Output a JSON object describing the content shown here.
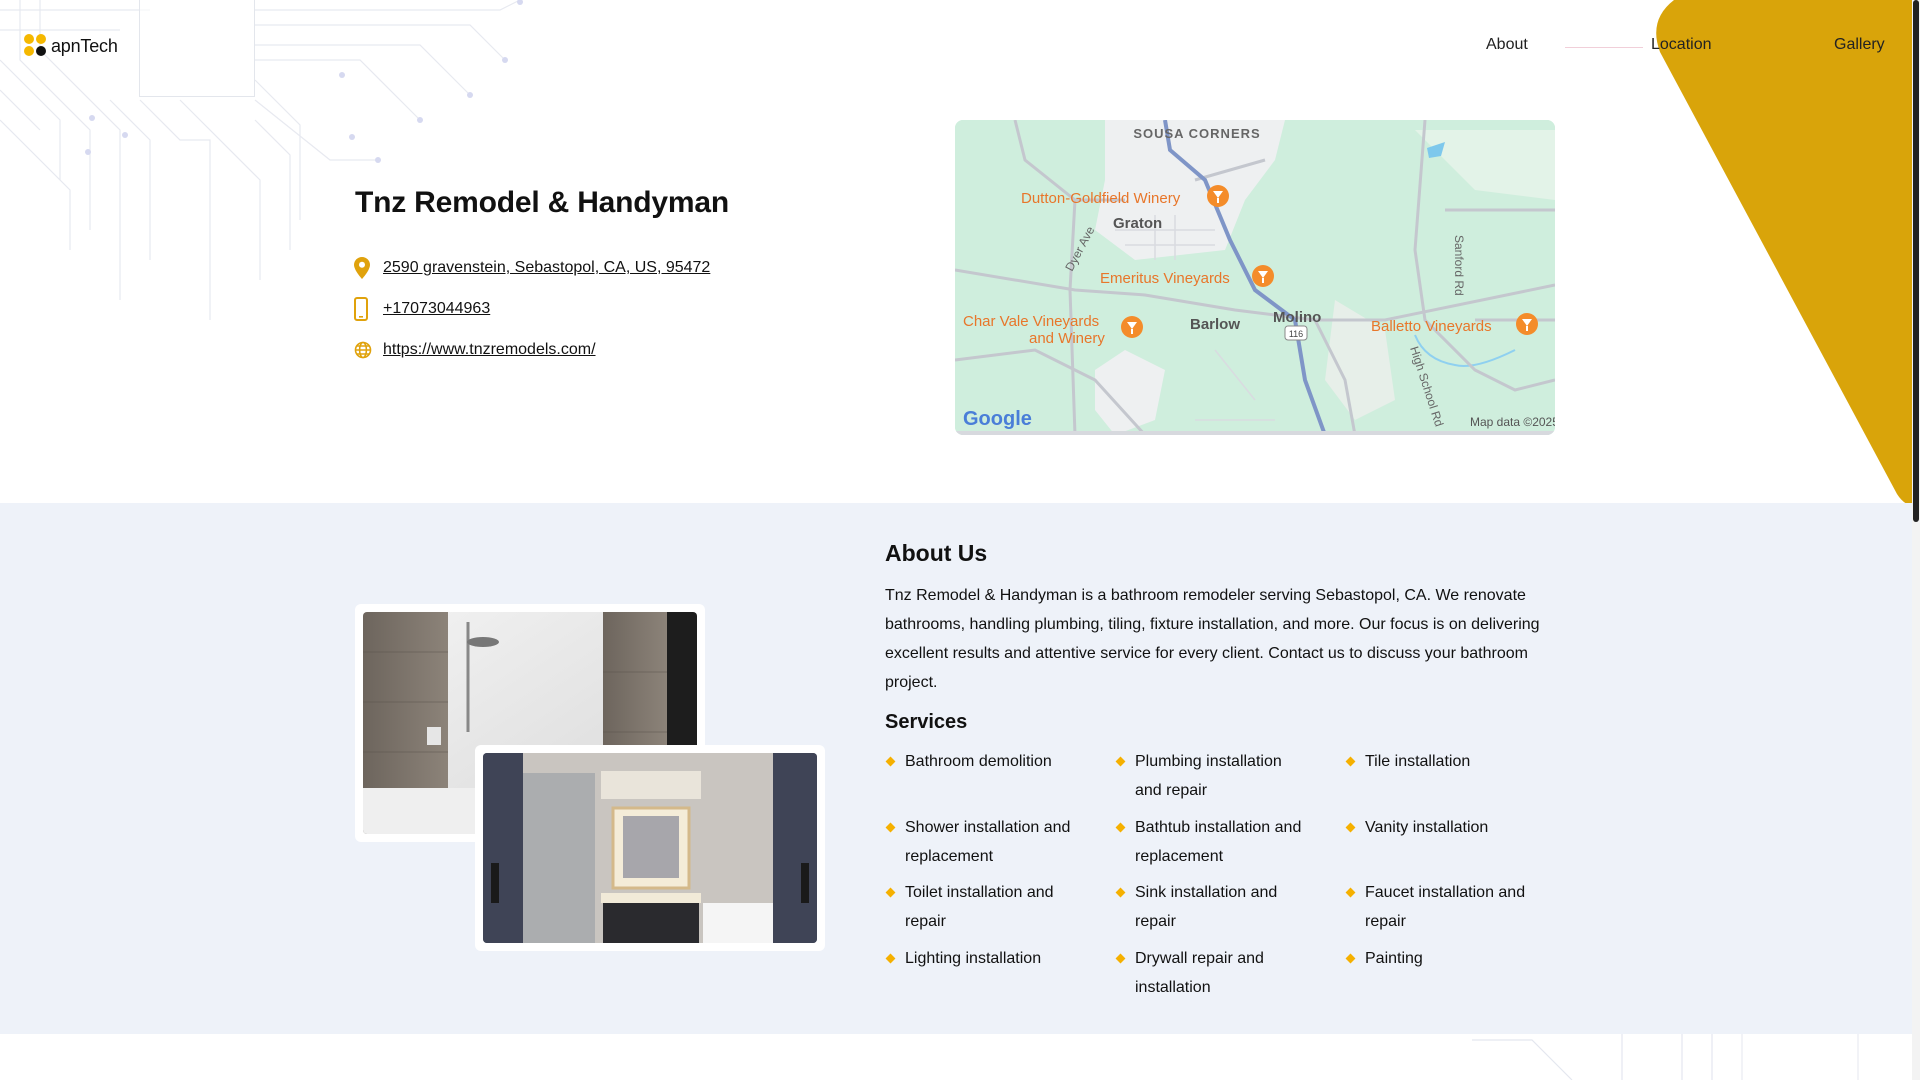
{
  "header": {
    "logo_text": "apnTech",
    "nav": {
      "about": "About",
      "location": "Location",
      "gallery": "Gallery"
    }
  },
  "business": {
    "name": "Tnz Remodel & Handyman",
    "address": "2590 gravenstein, Sebastopol, CA, US, 95472",
    "phone": "+17073044963",
    "website": "https://www.tnzremodels.com/"
  },
  "map": {
    "labels": {
      "sousa_corners": "SOUSA CORNERS",
      "dutton": "Dutton-Goldfield Winery",
      "graton": "Graton",
      "dyer_ave": "Dyer Ave",
      "emeritus": "Emeritus Vineyards",
      "char_vale_1": "Char Vale Vineyards",
      "char_vale_2": "and Winery",
      "barlow": "Barlow",
      "molino": "Molino",
      "route": "116",
      "balletto": "Balletto Vineyards",
      "sanford_rd": "Sanford Rd",
      "high_school_rd": "High School Rd",
      "google": "Google",
      "map_data": "Map data ©2025"
    }
  },
  "about": {
    "title": "About Us",
    "text": "Tnz Remodel & Handyman is a bathroom remodeler serving Sebastopol, CA. We renovate bathrooms, handling plumbing, tiling, fixture installation, and more. Our focus is on delivering excellent results and attentive service for every client. Contact us to discuss your bathroom project.",
    "services_title": "Services",
    "services": [
      "Bathroom demolition",
      "Plumbing installation and repair",
      "Tile installation",
      "Shower installation and replacement",
      "Bathtub installation and replacement",
      "Vanity installation",
      "Toilet installation and repair",
      "Sink installation and repair",
      "Faucet installation and repair",
      "Lighting installation",
      "Drywall repair and installation",
      "Painting"
    ]
  },
  "colors": {
    "accent_gold": "#d9a40a",
    "bullet": "#f5b000",
    "section_bg": "#eef2f9",
    "map_marker": "#f48c2a"
  },
  "icons": {
    "address": "location-pin-icon",
    "phone": "mobile-phone-icon",
    "website": "globe-icon"
  }
}
